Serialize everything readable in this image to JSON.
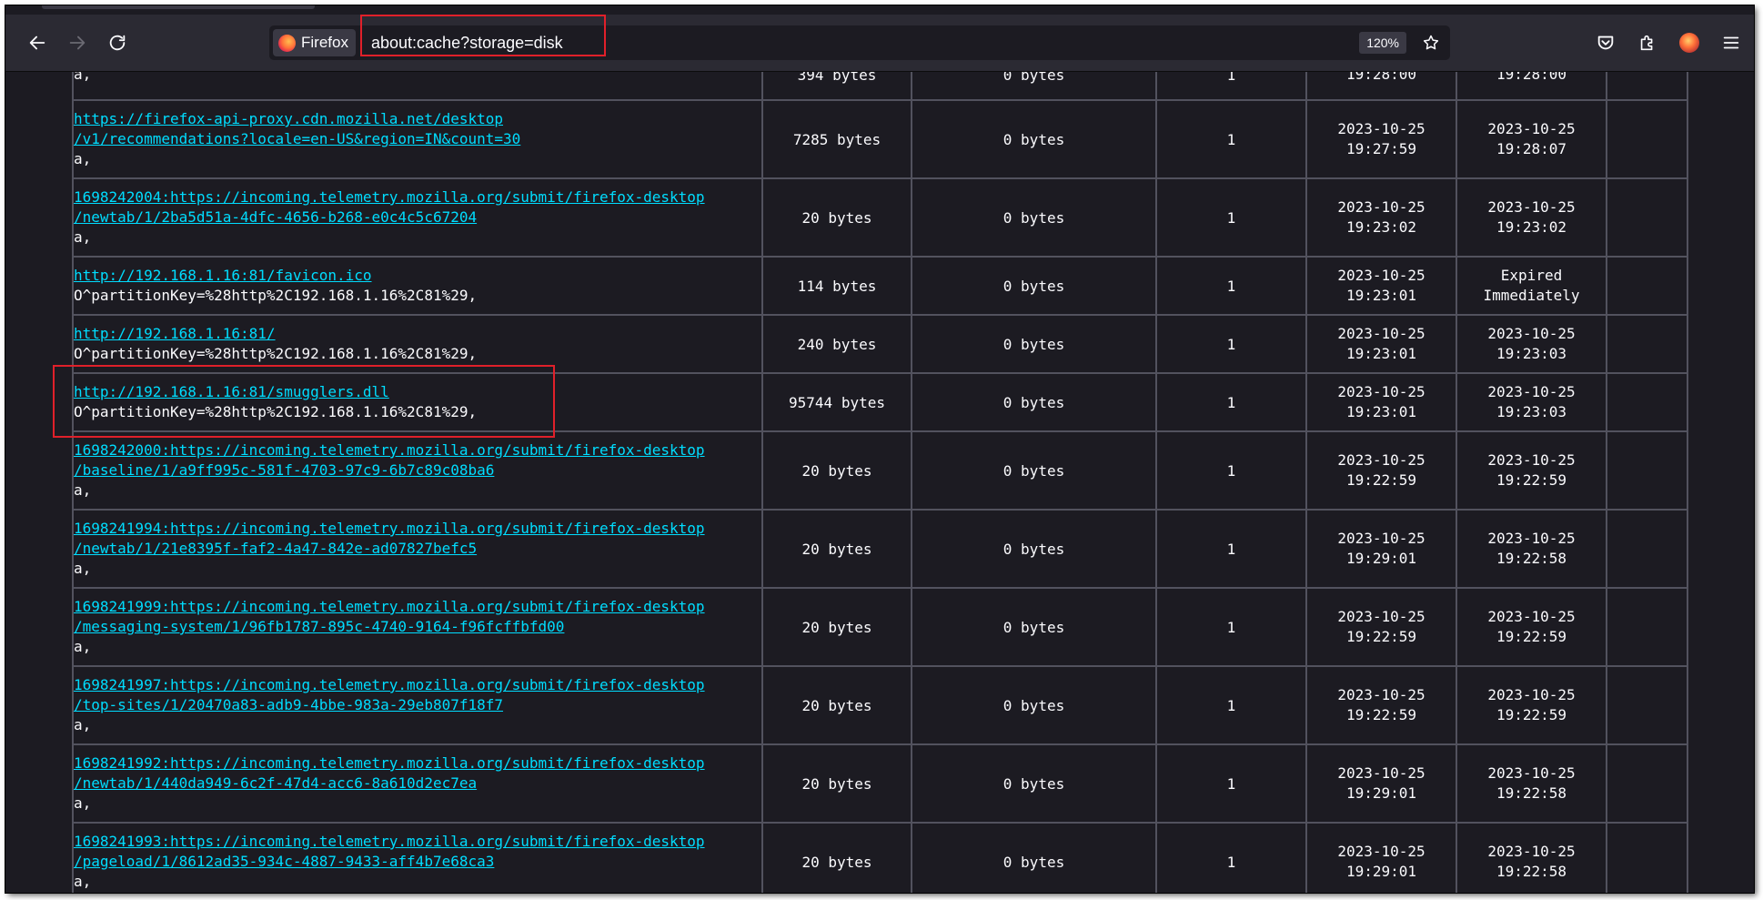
{
  "browser": {
    "identity_label": "Firefox",
    "url": "about:cache?storage=disk",
    "zoom": "120%",
    "buttons": [
      "back-icon",
      "forward-icon",
      "reload-icon",
      "bookmark-star-icon",
      "pocket-icon",
      "extensions-icon",
      "account-avatar",
      "menu-icon"
    ]
  },
  "colors": {
    "page_bg": "#1c1b22",
    "toolbar_bg": "#2b2a33",
    "link": "#00ddff",
    "highlight": "#e0202a",
    "border": "#52525e"
  },
  "cache_rows": [
    {
      "key": "",
      "key_suffix": "a,",
      "size": "394 bytes",
      "alt": "0 bytes",
      "fetch_count": "1",
      "last_modified": [
        "",
        "19:28:00"
      ],
      "expires": [
        "",
        "19:28:00"
      ]
    },
    {
      "key": "https://firefox-api-proxy.cdn.mozilla.net/desktop\n/v1/recommendations?locale=en-US&region=IN&count=30",
      "key_suffix": "a,",
      "size": "7285 bytes",
      "alt": "0 bytes",
      "fetch_count": "1",
      "last_modified": [
        "2023-10-25",
        "19:27:59"
      ],
      "expires": [
        "2023-10-25",
        "19:28:07"
      ]
    },
    {
      "key": "1698242004:https://incoming.telemetry.mozilla.org/submit/firefox-desktop\n/newtab/1/2ba5d51a-4dfc-4656-b268-e0c4c5c67204",
      "key_suffix": "a,",
      "size": "20 bytes",
      "alt": "0 bytes",
      "fetch_count": "1",
      "last_modified": [
        "2023-10-25",
        "19:23:02"
      ],
      "expires": [
        "2023-10-25",
        "19:23:02"
      ]
    },
    {
      "key": "http://192.168.1.16:81/favicon.ico",
      "key_suffix": "O^partitionKey=%28http%2C192.168.1.16%2C81%29,",
      "size": "114 bytes",
      "alt": "0 bytes",
      "fetch_count": "1",
      "last_modified": [
        "2023-10-25",
        "19:23:01"
      ],
      "expires": [
        "Expired",
        "Immediately"
      ]
    },
    {
      "key": "http://192.168.1.16:81/",
      "key_suffix": "O^partitionKey=%28http%2C192.168.1.16%2C81%29,",
      "size": "240 bytes",
      "alt": "0 bytes",
      "fetch_count": "1",
      "last_modified": [
        "2023-10-25",
        "19:23:01"
      ],
      "expires": [
        "2023-10-25",
        "19:23:03"
      ]
    },
    {
      "key": "http://192.168.1.16:81/smugglers.dll",
      "key_suffix": "O^partitionKey=%28http%2C192.168.1.16%2C81%29,",
      "size": "95744 bytes",
      "alt": "0 bytes",
      "fetch_count": "1",
      "last_modified": [
        "2023-10-25",
        "19:23:01"
      ],
      "expires": [
        "2023-10-25",
        "19:23:03"
      ],
      "highlighted": true
    },
    {
      "key": "1698242000:https://incoming.telemetry.mozilla.org/submit/firefox-desktop\n/baseline/1/a9ff995c-581f-4703-97c9-6b7c89c08ba6",
      "key_suffix": "a,",
      "size": "20 bytes",
      "alt": "0 bytes",
      "fetch_count": "1",
      "last_modified": [
        "2023-10-25",
        "19:22:59"
      ],
      "expires": [
        "2023-10-25",
        "19:22:59"
      ]
    },
    {
      "key": "1698241994:https://incoming.telemetry.mozilla.org/submit/firefox-desktop\n/newtab/1/21e8395f-faf2-4a47-842e-ad07827befc5",
      "key_suffix": "a,",
      "size": "20 bytes",
      "alt": "0 bytes",
      "fetch_count": "1",
      "last_modified": [
        "2023-10-25",
        "19:29:01"
      ],
      "expires": [
        "2023-10-25",
        "19:22:58"
      ]
    },
    {
      "key": "1698241999:https://incoming.telemetry.mozilla.org/submit/firefox-desktop\n/messaging-system/1/96fb1787-895c-4740-9164-f96fcffbfd00",
      "key_suffix": "a,",
      "size": "20 bytes",
      "alt": "0 bytes",
      "fetch_count": "1",
      "last_modified": [
        "2023-10-25",
        "19:22:59"
      ],
      "expires": [
        "2023-10-25",
        "19:22:59"
      ]
    },
    {
      "key": "1698241997:https://incoming.telemetry.mozilla.org/submit/firefox-desktop\n/top-sites/1/20470a83-adb9-4bbe-983a-29eb807f18f7",
      "key_suffix": "a,",
      "size": "20 bytes",
      "alt": "0 bytes",
      "fetch_count": "1",
      "last_modified": [
        "2023-10-25",
        "19:22:59"
      ],
      "expires": [
        "2023-10-25",
        "19:22:59"
      ]
    },
    {
      "key": "1698241992:https://incoming.telemetry.mozilla.org/submit/firefox-desktop\n/newtab/1/440da949-6c2f-47d4-acc6-8a610d2ec7ea",
      "key_suffix": "a,",
      "size": "20 bytes",
      "alt": "0 bytes",
      "fetch_count": "1",
      "last_modified": [
        "2023-10-25",
        "19:29:01"
      ],
      "expires": [
        "2023-10-25",
        "19:22:58"
      ]
    },
    {
      "key": "1698241993:https://incoming.telemetry.mozilla.org/submit/firefox-desktop\n/pageload/1/8612ad35-934c-4887-9433-aff4b7e68ca3",
      "key_suffix": "a,",
      "size": "20 bytes",
      "alt": "0 bytes",
      "fetch_count": "1",
      "last_modified": [
        "2023-10-25",
        "19:29:01"
      ],
      "expires": [
        "2023-10-25",
        "19:22:58"
      ]
    }
  ]
}
